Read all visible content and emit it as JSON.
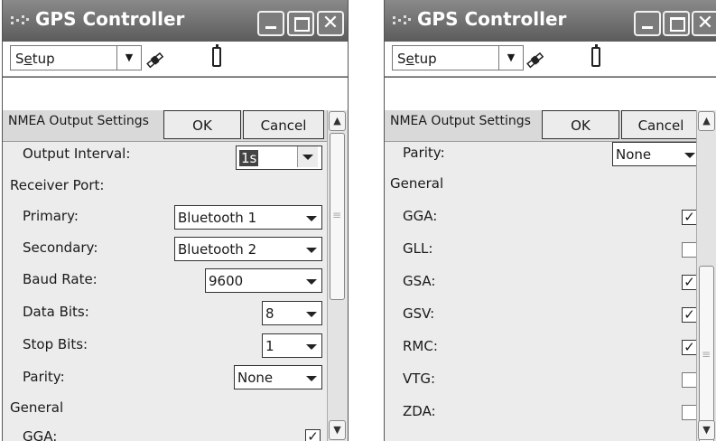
{
  "window": {
    "title": "GPS Controller",
    "menu_label": "Setup",
    "mnemonic_letter": "e",
    "section_title": "NMEA Output Settings",
    "ok_label": "OK",
    "cancel_label": "Cancel",
    "buttons": {
      "minimize": "minimize-icon",
      "maximize": "maximize-icon",
      "close": "close-icon"
    }
  },
  "left_pane": {
    "output_interval": {
      "label": "Output Interval:",
      "value": "1s"
    },
    "receiver_port_label": "Receiver Port:",
    "primary": {
      "label": "Primary:",
      "value": "Bluetooth 1"
    },
    "secondary": {
      "label": "Secondary:",
      "value": "Bluetooth 2"
    },
    "baud_rate": {
      "label": "Baud Rate:",
      "value": "9600"
    },
    "data_bits": {
      "label": "Data Bits:",
      "value": "8"
    },
    "stop_bits": {
      "label": "Stop Bits:",
      "value": "1"
    },
    "parity": {
      "label": "Parity:",
      "value": "None"
    },
    "general_label": "General",
    "gga": {
      "label": "GGA:",
      "checked": true
    }
  },
  "right_pane": {
    "parity": {
      "label": "Parity:",
      "value": "None"
    },
    "general_label": "General",
    "sentences": [
      {
        "label": "GGA:",
        "checked": true
      },
      {
        "label": "GLL:",
        "checked": false
      },
      {
        "label": "GSA:",
        "checked": true
      },
      {
        "label": "GSV:",
        "checked": true
      },
      {
        "label": "RMC:",
        "checked": true
      },
      {
        "label": "VTG:",
        "checked": false
      },
      {
        "label": "ZDA:",
        "checked": false
      }
    ]
  },
  "check_glyph": "✓"
}
